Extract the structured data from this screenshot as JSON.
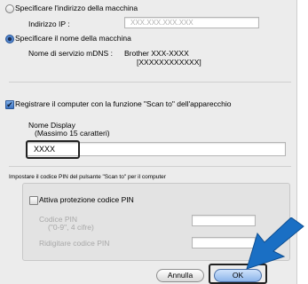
{
  "addr_section": {
    "radio_label": "Specificare l'indirizzo della macchina",
    "ip_label": "Indirizzo IP :",
    "ip_placeholder": "XXX.XXX.XXX.XXX"
  },
  "name_section": {
    "radio_label": "Specificare il nome della macchina",
    "service_label": "Nome di servizio mDNS :",
    "service_value_line1": "Brother XXX-XXXX",
    "service_value_line2": "[XXXXXXXXXXXX]"
  },
  "register": {
    "checkbox_label": "Registrare il computer con la funzione \"Scan to\" dell'apparecchio",
    "display_label": "Nome Display",
    "display_hint": "(Massimo 15 caratteri)",
    "display_value": "XXXX"
  },
  "pin": {
    "section_label": "Impostare il codice PIN del pulsante \"Scan to\" per il computer",
    "checkbox_label": "Attiva protezione codice PIN",
    "code_label": "Codice PIN",
    "code_hint": "(\"0-9\", 4 cifre)",
    "confirm_label": "Ridigitare codice PIN"
  },
  "buttons": {
    "cancel": "Annulla",
    "ok": "OK"
  },
  "colors": {
    "arrow": "#1a6fc4",
    "dialog_bg": "#ececec"
  }
}
